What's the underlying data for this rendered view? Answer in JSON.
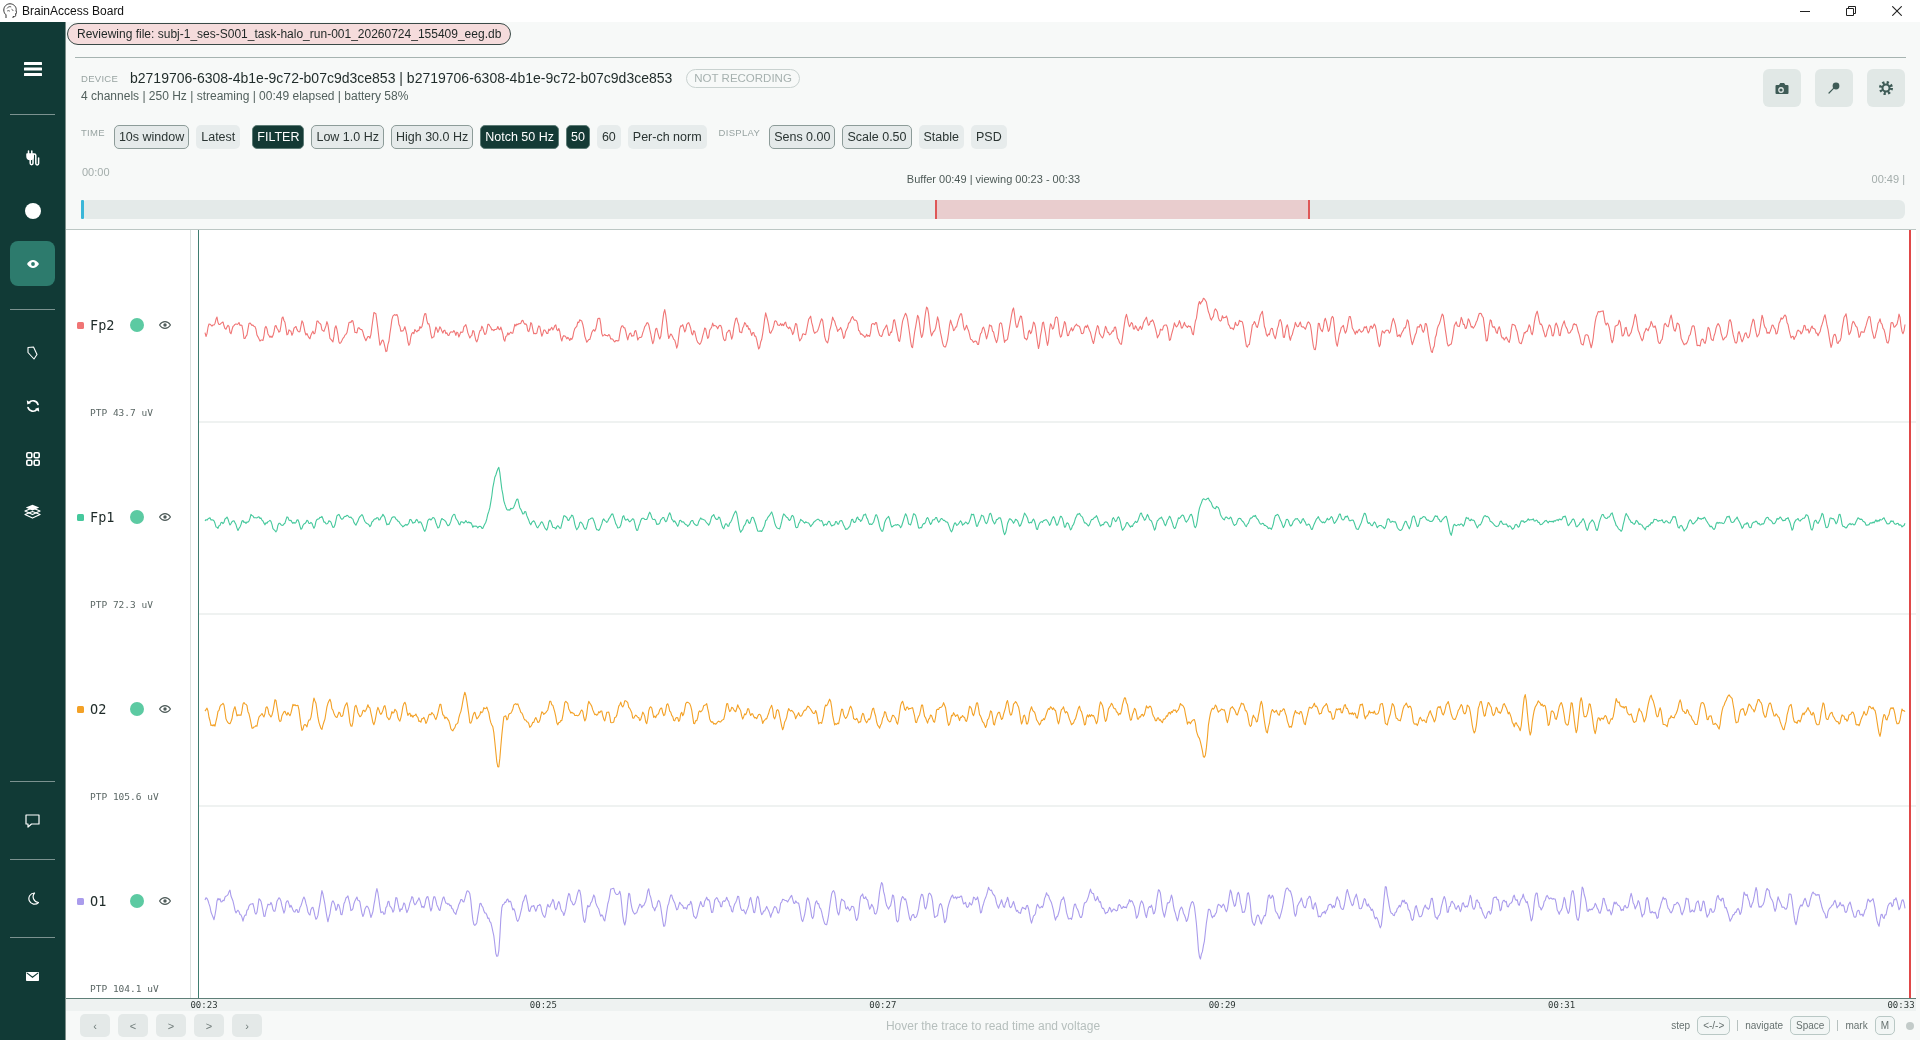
{
  "window": {
    "title": "BrainAccess Board"
  },
  "sidebar": {
    "top_groups": [
      {
        "items": [
          {
            "kind": "menu",
            "selected": false
          }
        ]
      },
      {
        "items": [
          {
            "kind": "connect",
            "selected": false
          },
          {
            "kind": "record",
            "selected": false
          },
          {
            "kind": "view",
            "selected": true
          }
        ]
      },
      {
        "items": [
          {
            "kind": "tag",
            "selected": false
          },
          {
            "kind": "sync",
            "selected": false
          },
          {
            "kind": "apps",
            "selected": false
          },
          {
            "kind": "library",
            "selected": false
          }
        ]
      }
    ],
    "bottom_groups": [
      {
        "items": [
          {
            "kind": "chat",
            "selected": false
          }
        ]
      },
      {
        "items": [
          {
            "kind": "theme",
            "selected": false
          }
        ]
      },
      {
        "items": [
          {
            "kind": "mail",
            "selected": false
          }
        ]
      }
    ]
  },
  "review_banner": {
    "text": "Reviewing file: subj-1_ses-S001_task-halo_run-001_20260724_155409_eeg.db"
  },
  "device": {
    "label": "DEVICE",
    "name": "b2719706-6308-4b1e-9c72-b07c9d3ce853 | b2719706-6308-4b1e-9c72-b07c9d3ce853",
    "recording": false,
    "status": "NOT RECORDING",
    "summary": "4 channels | 250 Hz | streaming | 00:49 elapsed | battery 58%"
  },
  "toolbar": {
    "sections": [
      {
        "label": "TIME",
        "controls": [
          {
            "kind": "field",
            "text": "10s window"
          },
          {
            "kind": "toggle",
            "text": "Latest",
            "on": false
          }
        ]
      },
      {
        "controls": [
          {
            "kind": "toggle",
            "text": "FILTER",
            "on": true
          },
          {
            "kind": "field",
            "text": "Low 1.0 Hz"
          },
          {
            "kind": "field",
            "text": "High 30.0 Hz"
          },
          {
            "kind": "toggle",
            "text": "Notch 50 Hz",
            "on": true
          },
          {
            "kind": "choice",
            "text": "50",
            "selected": true
          },
          {
            "kind": "choice",
            "text": "60",
            "selected": false
          },
          {
            "kind": "toggle",
            "text": "Per-ch norm",
            "on": false
          }
        ]
      },
      {
        "label": "DISPLAY",
        "controls": [
          {
            "kind": "field",
            "text": "Sens 0.00"
          },
          {
            "kind": "field",
            "text": "Scale 0.50"
          },
          {
            "kind": "toggle",
            "text": "Stable",
            "on": false
          },
          {
            "kind": "toggle",
            "text": "PSD",
            "on": false
          }
        ]
      }
    ]
  },
  "timeline": {
    "start_label": "00:00",
    "summary": "Buffer 00:49 | viewing 00:23 - 00:33",
    "end_label": "00:49 |",
    "view_range": {
      "start": {
        "level": 0.469
      },
      "end": {
        "level": 0.673
      }
    }
  },
  "plot": {
    "channels": [
      {
        "name": "Fp2",
        "color": "#f07575",
        "signal_ok": true,
        "visible": true,
        "ptp": "PTP 43.7 uV"
      },
      {
        "name": "Fp1",
        "color": "#45c89c",
        "signal_ok": true,
        "visible": true,
        "ptp": "PTP 72.3 uV"
      },
      {
        "name": "O2",
        "color": "#f3a126",
        "signal_ok": true,
        "visible": true,
        "ptp": "PTP 105.6 uV"
      },
      {
        "name": "O1",
        "color": "#aa9cec",
        "signal_ok": true,
        "visible": true,
        "ptp": "PTP 104.1 uV"
      }
    ],
    "time_axis": {
      "ticks": [
        "00:23",
        "00:25",
        "00:27",
        "00:29",
        "00:31",
        "00:33"
      ]
    }
  },
  "footer": {
    "nav_buttons": [
      "‹",
      "<",
      ">",
      ">",
      "›"
    ],
    "hint": "Hover the trace to read time and voltage",
    "shortcuts": [
      {
        "label": "step",
        "key": "<-/->"
      },
      {
        "label": "navigate",
        "key": "Space"
      },
      {
        "label": "mark",
        "key": "M"
      }
    ]
  }
}
